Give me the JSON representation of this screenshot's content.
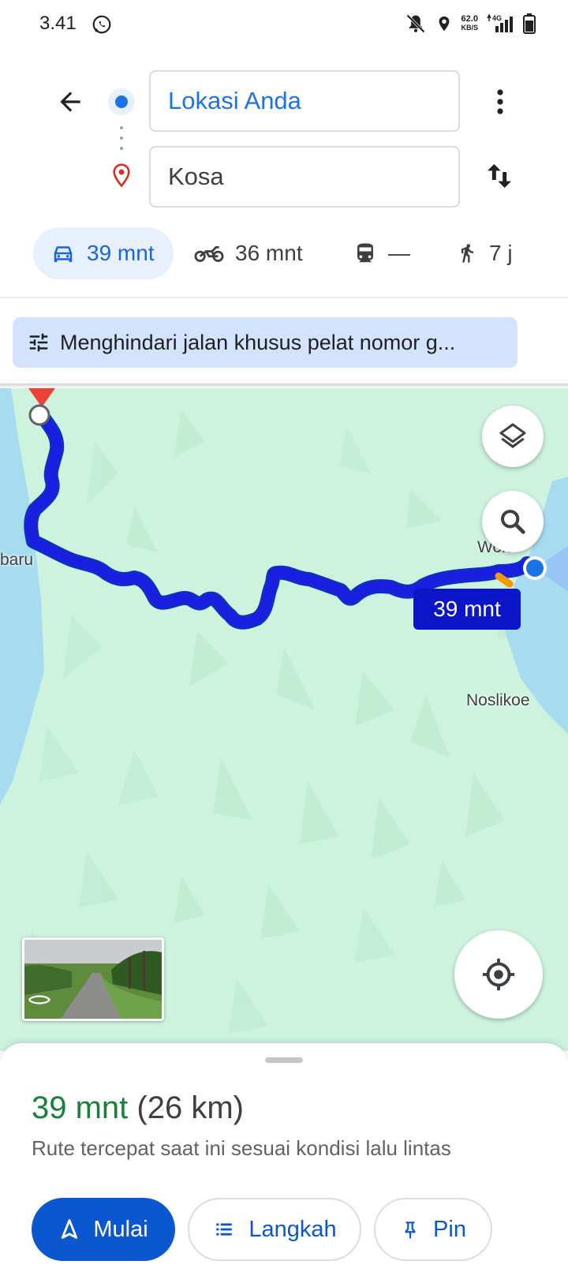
{
  "status_bar": {
    "time": "3.41",
    "speed_value": "62.0",
    "speed_unit": "KB/S",
    "network": "4G"
  },
  "search": {
    "origin": "Lokasi Anda",
    "destination": "Kosa"
  },
  "modes": [
    {
      "name": "car",
      "label": "39 mnt",
      "selected": true
    },
    {
      "name": "motorcycle",
      "label": "36 mnt"
    },
    {
      "name": "transit",
      "label": "—"
    },
    {
      "name": "walk",
      "label": "7 j"
    }
  ],
  "preference_chip": {
    "label": "Menghindari jalan khusus pelat nomor g..."
  },
  "map": {
    "place_labels": [
      "baru",
      "Wolu",
      "Noslikoe"
    ],
    "route_badge": "39 mnt"
  },
  "route_summary": {
    "duration": "39 mnt",
    "distance": "(26 km)",
    "description": "Rute tercepat saat ini sesuai kondisi lalu lintas"
  },
  "actions": {
    "start": "Mulai",
    "steps": "Langkah",
    "pin": "Pin"
  },
  "colors": {
    "primary": "#1a73e8",
    "route": "#1a1ee0",
    "map_land": "#cdf3df",
    "water": "#a7dcf0",
    "success": "#188038"
  }
}
